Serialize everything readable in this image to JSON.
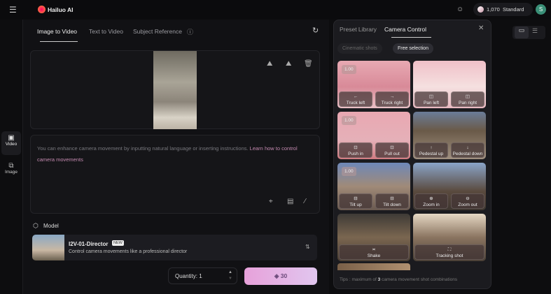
{
  "header": {
    "brand": "Hailuo AI",
    "credits": "1,070",
    "plan": "Standard",
    "avatar_letter": "S"
  },
  "rail": [
    {
      "label": "Video",
      "icon": "video-icon"
    },
    {
      "label": "Image",
      "icon": "image-icon"
    }
  ],
  "tabs": [
    {
      "label": "Image to Video",
      "active": true
    },
    {
      "label": "Text to Video"
    },
    {
      "label": "Subject Reference"
    }
  ],
  "prompt": {
    "placeholder": "You can enhance camera movement by inputting natural language or inserting instructions.",
    "link": "Learn how to control camera movements"
  },
  "model": {
    "section_label": "Model",
    "name": "I2V-01-Director",
    "badge": "NEW",
    "description": "Control camera movements like a professional director"
  },
  "quantity": {
    "label": "Quantity: 1"
  },
  "generate": {
    "cost": "30"
  },
  "panel": {
    "tabs": [
      "Preset Library",
      "Camera Control"
    ],
    "active_tab": "Camera Control",
    "filters": [
      "Cinematic shots",
      "Free selection"
    ],
    "active_filter": "Free selection",
    "cards": [
      {
        "badge": "1.00",
        "buttons": [
          {
            "icon": "←",
            "label": "Truck left"
          },
          {
            "icon": "→",
            "label": "Truck right"
          }
        ]
      },
      {
        "badge": "",
        "buttons": [
          {
            "icon": "◫",
            "label": "Pan left"
          },
          {
            "icon": "◫",
            "label": "Pan right"
          }
        ]
      },
      {
        "badge": "1.00",
        "buttons": [
          {
            "icon": "⊡",
            "label": "Push in"
          },
          {
            "icon": "⊡",
            "label": "Pull out"
          }
        ]
      },
      {
        "badge": "",
        "buttons": [
          {
            "icon": "↑",
            "label": "Pedestal up"
          },
          {
            "icon": "↓",
            "label": "Pedestal down"
          }
        ]
      },
      {
        "badge": "1.00",
        "buttons": [
          {
            "icon": "⊟",
            "label": "Tilt up"
          },
          {
            "icon": "⊟",
            "label": "Tilt down"
          }
        ]
      },
      {
        "badge": "",
        "buttons": [
          {
            "icon": "⊕",
            "label": "Zoom in"
          },
          {
            "icon": "⊖",
            "label": "Zoom out"
          }
        ]
      },
      {
        "badge": "",
        "buttons": [
          {
            "icon": "≍",
            "label": "Shake"
          }
        ]
      },
      {
        "badge": "",
        "buttons": [
          {
            "icon": "⛶",
            "label": "Tracking shot"
          }
        ]
      }
    ],
    "tips_prefix": "Tips :  maximum of ",
    "tips_count": "3",
    "tips_suffix": " camera movement shot combinations"
  }
}
